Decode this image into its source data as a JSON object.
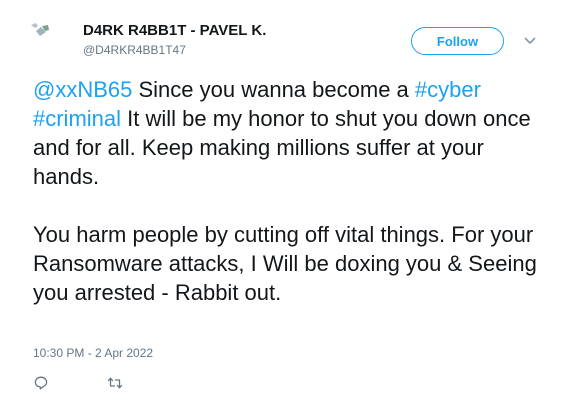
{
  "author": {
    "name": "D4RK R4BB1T - PAVEL K.",
    "handle": "@D4RKR4BB1T47",
    "avatar_icon": "broken-image-icon"
  },
  "follow_label": "Follow",
  "tweet": {
    "para1": {
      "mention": "@xxNB65",
      "t1": " Since you wanna become a ",
      "hashtag1": "#cyber",
      "t2": " ",
      "hashtag2": "#criminal",
      "t3": " It will be my honor to shut you down once and for all. Keep making millions suffer at your hands."
    },
    "para2": "You harm people by cutting off vital things. For your Ransomware attacks, I Will be doxing you & Seeing you arrested - Rabbit out."
  },
  "timestamp": "10:30 PM - 2 Apr 2022",
  "actions": {
    "reply_icon": "reply-icon",
    "retweet_icon": "retweet-icon",
    "more_icon": "chevron-down-icon"
  },
  "colors": {
    "accent": "#1da1f2",
    "text": "#14171a",
    "muted": "#657786"
  }
}
